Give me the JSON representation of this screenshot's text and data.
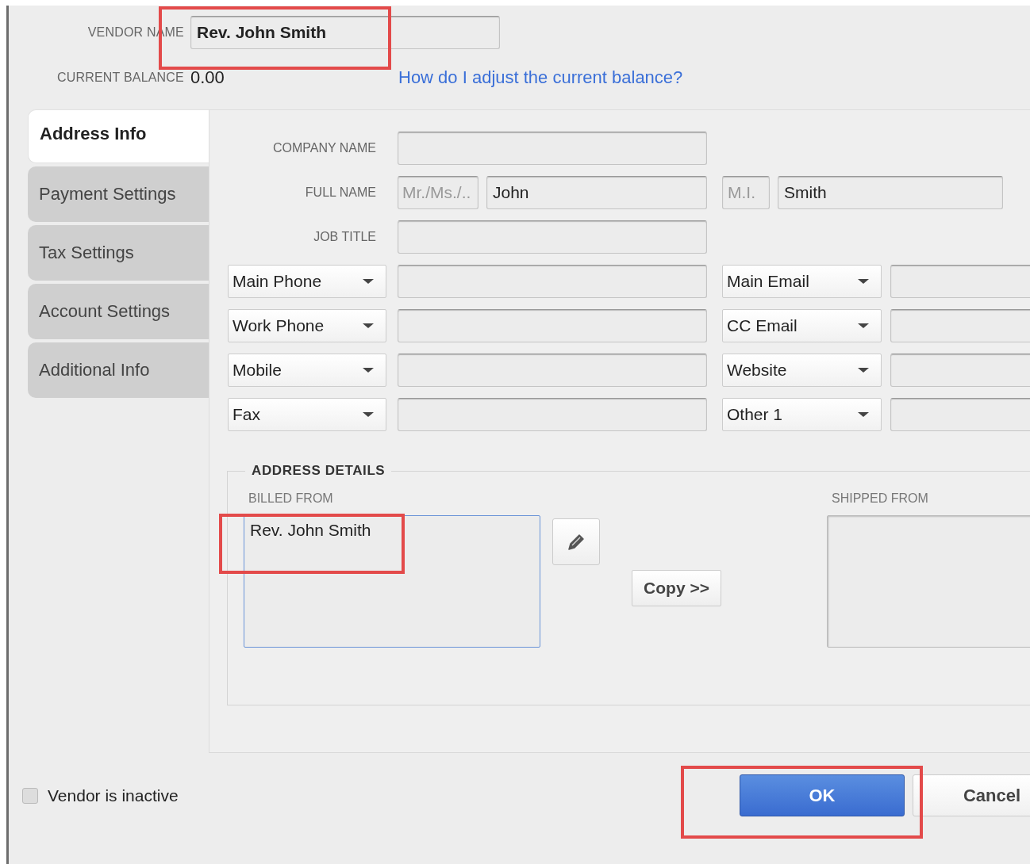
{
  "vendor_name": {
    "label": "VENDOR NAME",
    "value": "Rev. John Smith"
  },
  "current_balance": {
    "label": "CURRENT BALANCE",
    "value": "0.00"
  },
  "help_link": "How do I adjust the current balance?",
  "tabs": [
    {
      "label": "Address Info",
      "selected": true
    },
    {
      "label": "Payment Settings",
      "selected": false
    },
    {
      "label": "Tax Settings",
      "selected": false
    },
    {
      "label": "Account Settings",
      "selected": false
    },
    {
      "label": "Additional Info",
      "selected": false
    }
  ],
  "company_name": {
    "label": "COMPANY NAME"
  },
  "full_name": {
    "label": "FULL NAME",
    "title_placeholder": "Mr./Ms./..",
    "first": "John",
    "middle_placeholder": "M.I.",
    "last": "Smith"
  },
  "job_title": {
    "label": "JOB TITLE"
  },
  "contact_rows": [
    {
      "phone_type": "Main Phone",
      "online_type": "Main Email"
    },
    {
      "phone_type": "Work Phone",
      "online_type": "CC Email"
    },
    {
      "phone_type": "Mobile",
      "online_type": "Website"
    },
    {
      "phone_type": "Fax",
      "online_type": "Other 1"
    }
  ],
  "address_details": {
    "title": "ADDRESS DETAILS",
    "billed_from": {
      "label": "BILLED FROM",
      "value": "Rev. John Smith"
    },
    "copy_button": "Copy >>",
    "shipped_from": {
      "label": "SHIPPED FROM"
    }
  },
  "vendor_inactive": {
    "label": "Vendor is inactive",
    "checked": false
  },
  "buttons": [
    {
      "label": "OK",
      "kind": "primary"
    },
    {
      "label": "Cancel",
      "kind": "secondary"
    }
  ]
}
